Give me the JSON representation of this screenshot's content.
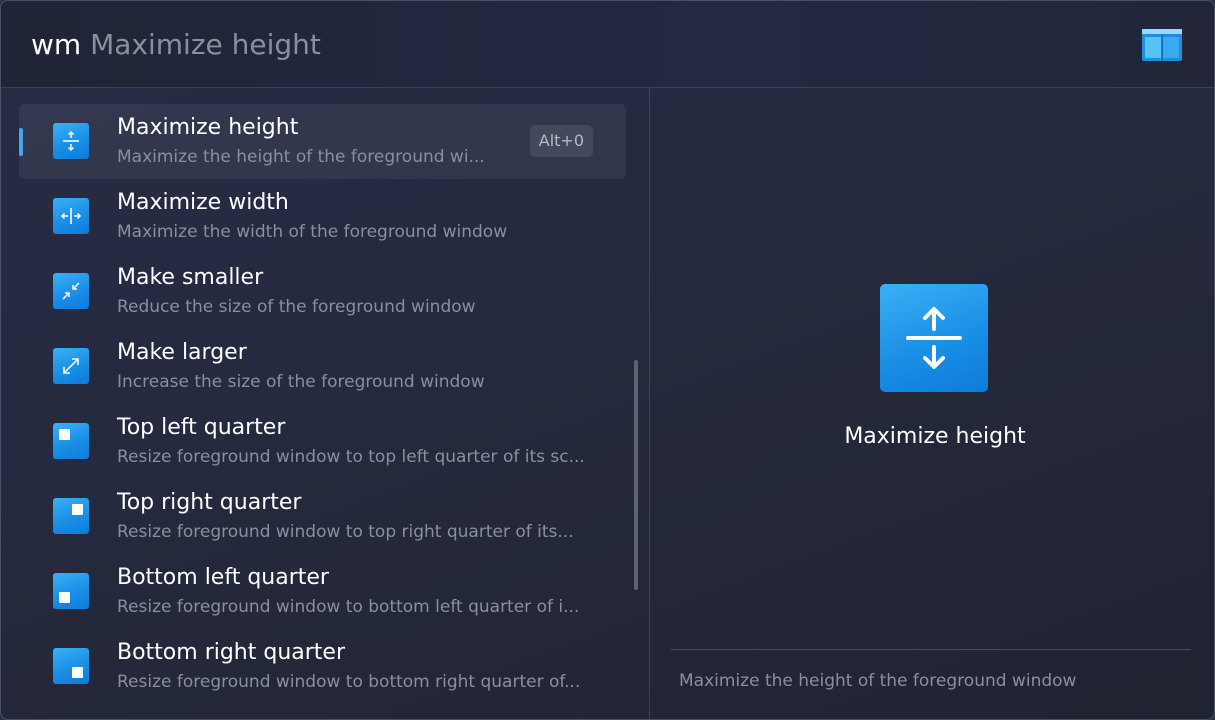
{
  "search": {
    "keyword": "wm",
    "query": "Maximize height"
  },
  "app_logo": {
    "icon": "window-layout-icon",
    "color": "#29a8f0"
  },
  "results": [
    {
      "title": "Maximize height",
      "subtitle": "Maximize the height of the foreground wi...",
      "icon": "maximize-height-icon",
      "selected": true,
      "shortcut": "Alt+0"
    },
    {
      "title": "Maximize width",
      "subtitle": "Maximize the width of the foreground window",
      "icon": "maximize-width-icon"
    },
    {
      "title": "Make smaller",
      "subtitle": "Reduce the size of the foreground window",
      "icon": "make-smaller-icon"
    },
    {
      "title": "Make larger",
      "subtitle": "Increase the size of the foreground window",
      "icon": "make-larger-icon"
    },
    {
      "title": "Top left quarter",
      "subtitle": "Resize foreground window to top left quarter of its sc...",
      "icon": "top-left-quarter-icon"
    },
    {
      "title": "Top right quarter",
      "subtitle": "Resize foreground window to top right quarter of its...",
      "icon": "top-right-quarter-icon"
    },
    {
      "title": "Bottom left quarter",
      "subtitle": "Resize foreground window to bottom left quarter of i...",
      "icon": "bottom-left-quarter-icon"
    },
    {
      "title": "Bottom right quarter",
      "subtitle": "Resize foreground window to bottom right quarter of...",
      "icon": "bottom-right-quarter-icon"
    }
  ],
  "detail": {
    "title": "Maximize height",
    "description": "Maximize the height of the foreground window",
    "icon": "maximize-height-icon"
  },
  "colors": {
    "accent": "#4aa3f0",
    "icon_blue": "#1a8fe6",
    "text_primary": "#ffffff",
    "text_secondary": "#8a8f9e"
  }
}
